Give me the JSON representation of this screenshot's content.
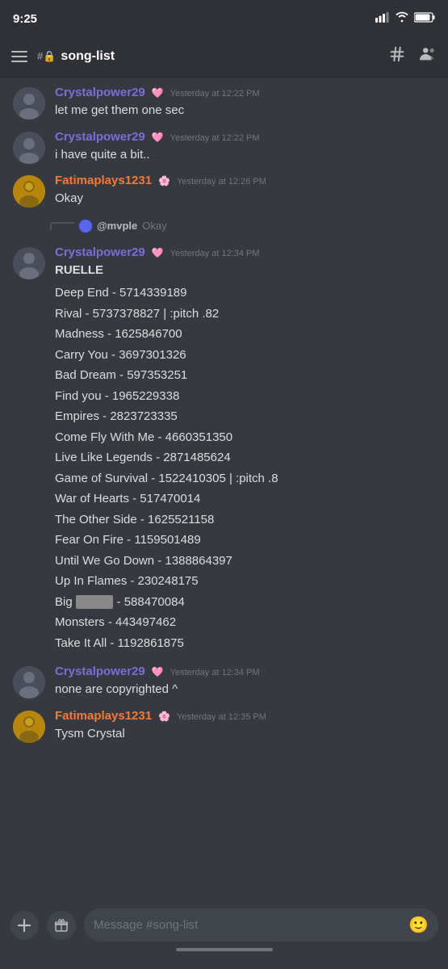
{
  "statusBar": {
    "time": "9:25",
    "locationIcon": "▶",
    "signalIcon": "📶",
    "wifiIcon": "WiFi",
    "batteryIcon": "🔋"
  },
  "header": {
    "channelName": "song-list",
    "hashIcon": "#",
    "lockIcon": "🔒",
    "searchIcon": "#",
    "membersIcon": "👥"
  },
  "messages": [
    {
      "id": "msg1",
      "username": "Crystalpower29",
      "usernameClass": "username-purple",
      "timestamp": "Yesterday at 12:22 PM",
      "badge": "🩷",
      "text": "let me get them one sec",
      "continued": true
    },
    {
      "id": "msg2",
      "username": "Crystalpower29",
      "usernameClass": "username-purple",
      "timestamp": "Yesterday at 12:22 PM",
      "badge": "🩷",
      "text": "i have quite a bit.."
    },
    {
      "id": "msg3",
      "username": "Fatimaplays1231",
      "usernameClass": "username-orange",
      "timestamp": "Yesterday at 12:26 PM",
      "badge": "🌸",
      "text": "Okay"
    },
    {
      "id": "msg4",
      "username": "Crystalpower29",
      "usernameClass": "username-purple",
      "timestamp": "Yesterday at 12:34 PM",
      "badge": "🩷",
      "replyTo": {
        "replyUsername": "@mvple",
        "replyText": "Okay"
      },
      "headerText": "RUELLE",
      "songList": [
        "Deep End - 5714339189",
        "Rival - 5737378827 | :pitch .82",
        "Madness - 1625846700",
        "Carry You - 3697301326",
        "Bad Dream - 597353251",
        "Find you - 1965229338",
        "Empires - 2823723335",
        "Come Fly With Me - 4660351350",
        "Live Like Legends - 2871485624",
        "Game of Survival - 1522410305 | :pitch .8",
        "War of Hearts - 517470014",
        "The Other Side - 1625521158",
        "Fear On Fire - 1159501489",
        "Until We Go Down - 1388864397",
        "Up In Flames - 230248175",
        "Big [censored] - 588470084",
        "Monsters - 443497462",
        "Take It All - 1192861875"
      ]
    },
    {
      "id": "msg5",
      "username": "Crystalpower29",
      "usernameClass": "username-purple",
      "timestamp": "Yesterday at 12:34 PM",
      "badge": "🩷",
      "text": "none are copyrighted ^"
    },
    {
      "id": "msg6",
      "username": "Fatimaplays1231",
      "usernameClass": "username-orange",
      "timestamp": "Yesterday at 12:35 PM",
      "badge": "🌸",
      "text": "Tysm Crystal"
    }
  ],
  "inputBar": {
    "placeholder": "Message #song-list",
    "plusIcon": "+",
    "giftIcon": "🎁",
    "emojiIcon": "🙂"
  }
}
